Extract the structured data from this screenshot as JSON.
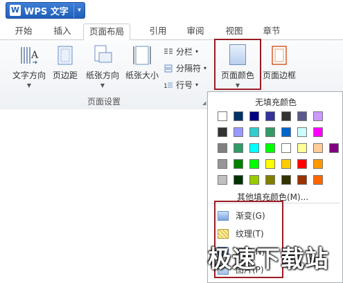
{
  "app": {
    "logo": "W",
    "title": "WPS 文字",
    "dropdown": "▾"
  },
  "tabs": [
    "开始",
    "插入",
    "页面布局",
    "引用",
    "审阅",
    "视图",
    "章节"
  ],
  "ribbon": {
    "text_direction": "文字方向",
    "margins": "页边距",
    "orientation": "纸张方向",
    "size": "纸张大小",
    "columns": "分栏",
    "breaks": "分隔符",
    "line_numbers": "行号",
    "page_color": "页面颜色",
    "page_border": "页面边框",
    "group_label": "页面设置"
  },
  "menu": {
    "no_fill": "无填充颜色",
    "more_colors": "其他填充颜色(M)...",
    "gradient": "渐变(G)",
    "texture": "纹理(T)",
    "pattern": "图案(N)",
    "picture": "图片(P)"
  },
  "swatch_colors": [
    [
      "#ffffff",
      "#003366",
      "#000080",
      "#333399",
      "#333333",
      "#5a5a8a",
      "#cc99ff"
    ],
    [
      "#333333",
      "#9999ff",
      "#33cccc",
      "#339966",
      "#0066cc",
      "#ccffff",
      "#ff00ff"
    ],
    [
      "#808080",
      "#339966",
      "#00ffff",
      "#00ff00",
      "#ffffff",
      "#ffff99",
      "#ffcc99",
      "#800080"
    ],
    [
      "#969696",
      "#008000",
      "#00ff00",
      "#ffff00",
      "#ffcc00",
      "#ff0000",
      "#ff9900"
    ],
    [
      "#c0c0c0",
      "#003300",
      "#99cc00",
      "#808000",
      "#333300",
      "#993300",
      "#ff6600"
    ]
  ],
  "watermark": "极速下载站"
}
